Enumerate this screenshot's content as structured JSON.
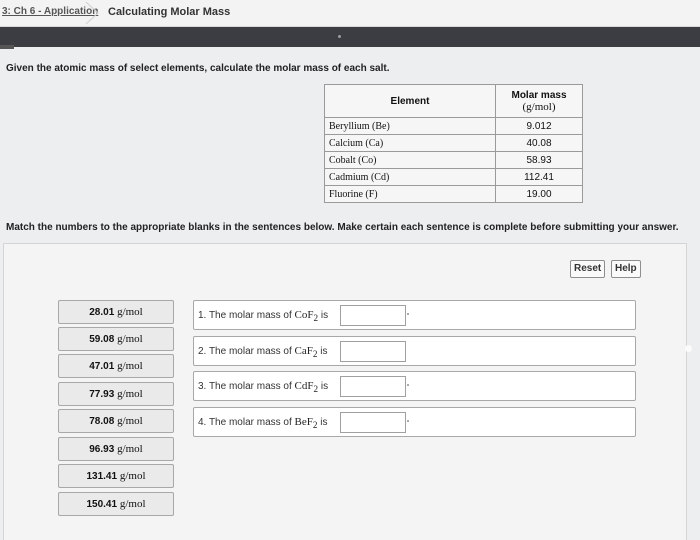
{
  "breadcrumb": {
    "current": "3: Ch 6 - Application",
    "activity": "Calculating Molar Mass"
  },
  "instructions": {
    "given": "Given the atomic mass of select elements, calculate the molar mass of each salt.",
    "match": "Match the numbers to the appropriate blanks in the sentences below. Make certain each sentence is complete before submitting your answer."
  },
  "table": {
    "header_element": "Element",
    "header_mass_1": "Molar mass",
    "header_mass_2": "(g/mol)",
    "rows": [
      {
        "element": "Beryllium (Be)",
        "mass": "9.012"
      },
      {
        "element": "Calcium (Ca)",
        "mass": "40.08"
      },
      {
        "element": "Cobalt (Co)",
        "mass": "58.93"
      },
      {
        "element": "Cadmium (Cd)",
        "mass": "112.41"
      },
      {
        "element": "Fluorine (F)",
        "mass": "19.00"
      }
    ]
  },
  "toolbar": {
    "reset_label": "Reset",
    "help_label": "Help"
  },
  "unit": "g/mol",
  "answers": [
    "28.01",
    "59.08",
    "47.01",
    "77.93",
    "78.08",
    "96.93",
    "131.41",
    "150.41"
  ],
  "sentences": [
    {
      "num": "1.",
      "pre": "The molar mass of",
      "formula": "CoF",
      "sub": "2",
      "post": "is"
    },
    {
      "num": "2.",
      "pre": "The molar mass of",
      "formula": "CaF",
      "sub": "2",
      "post": "is"
    },
    {
      "num": "3.",
      "pre": "The molar mass of",
      "formula": "CdF",
      "sub": "2",
      "post": "is"
    },
    {
      "num": "4.",
      "pre": "The molar mass of",
      "formula": "BeF",
      "sub": "2",
      "post": "is"
    }
  ]
}
